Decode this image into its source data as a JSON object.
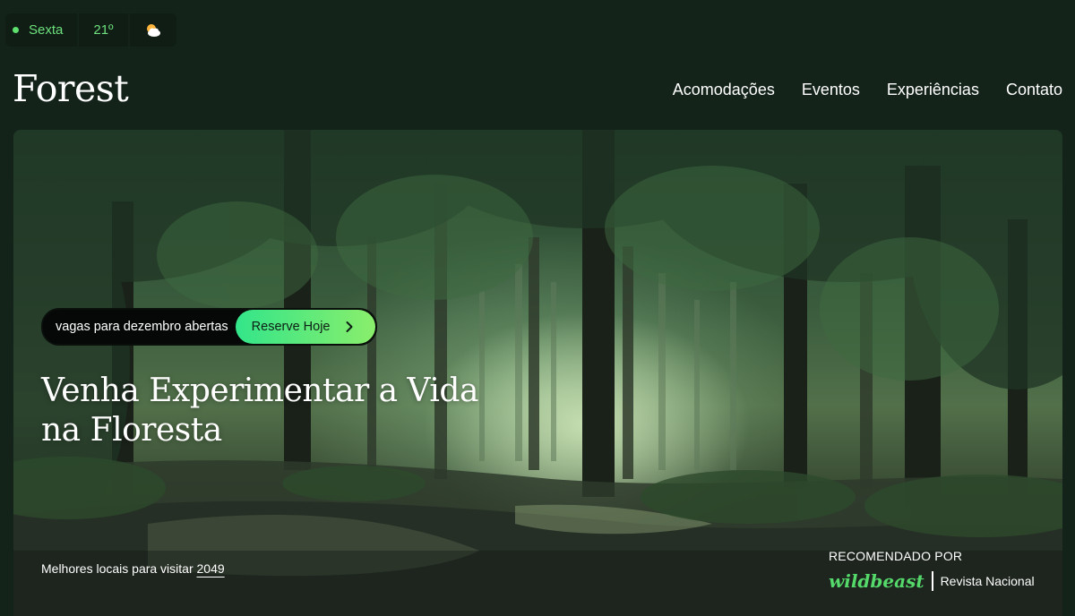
{
  "status": {
    "day": "Sexta",
    "temperature": "21º",
    "weather_icon": "partly-cloudy-icon"
  },
  "header": {
    "brand": "Forest",
    "nav": [
      {
        "label": "Acomodações"
      },
      {
        "label": "Eventos"
      },
      {
        "label": "Experiências"
      },
      {
        "label": "Contato"
      }
    ]
  },
  "hero": {
    "promo_text": "vagas para dezembro abertas",
    "cta_label": "Reserve Hoje",
    "headline": "Venha Experimentar a Vida na Floresta",
    "best_places_text": "Melhores locais para visitar",
    "best_places_year": "2049",
    "recommended_label": "RECOMENDADO POR",
    "recommended_brand": "wildbeast",
    "recommended_partner": "Revista Nacional"
  },
  "colors": {
    "background": "#13231a",
    "accent_green": "#55d96a",
    "cta_gradient_start": "#33e58a",
    "cta_gradient_end": "#8aee6c"
  }
}
